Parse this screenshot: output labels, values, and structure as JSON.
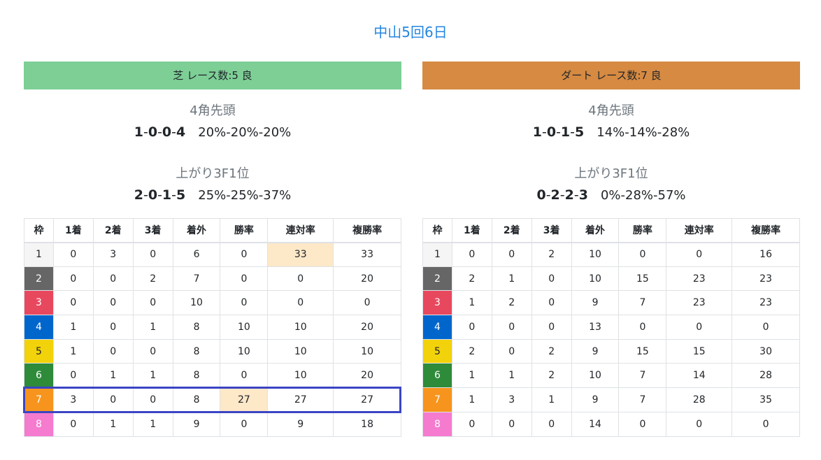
{
  "title": "中山5回6日",
  "headers": [
    "枠",
    "1着",
    "2着",
    "3着",
    "着外",
    "勝率",
    "連対率",
    "複勝率"
  ],
  "turf": {
    "header": "芝 レース数:5 良",
    "color": "#7dcf96",
    "sec1_label": "4角先頭",
    "sec1_rec": [
      "1",
      "0",
      "0",
      "4"
    ],
    "sec1_pct": "20%-20%-20%",
    "sec2_label": "上がり3F1位",
    "sec2_rec": [
      "2",
      "0",
      "1",
      "5"
    ],
    "sec2_pct": "25%-25%-37%",
    "rows": [
      [
        "1",
        "0",
        "3",
        "0",
        "6",
        "0",
        "33",
        "33"
      ],
      [
        "2",
        "0",
        "0",
        "2",
        "7",
        "0",
        "0",
        "20"
      ],
      [
        "3",
        "0",
        "0",
        "0",
        "10",
        "0",
        "0",
        "0"
      ],
      [
        "4",
        "1",
        "0",
        "1",
        "8",
        "10",
        "10",
        "20"
      ],
      [
        "5",
        "1",
        "0",
        "0",
        "8",
        "10",
        "10",
        "10"
      ],
      [
        "6",
        "0",
        "1",
        "1",
        "8",
        "0",
        "10",
        "20"
      ],
      [
        "7",
        "3",
        "0",
        "0",
        "8",
        "27",
        "27",
        "27"
      ],
      [
        "8",
        "0",
        "1",
        "1",
        "9",
        "0",
        "9",
        "18"
      ]
    ],
    "highlights": [
      [
        0,
        6
      ],
      [
        6,
        5
      ]
    ],
    "selected_row": 6
  },
  "dirt": {
    "header": "ダート レース数:7 良",
    "color": "#d68a42",
    "sec1_label": "4角先頭",
    "sec1_rec": [
      "1",
      "0",
      "1",
      "5"
    ],
    "sec1_pct": "14%-14%-28%",
    "sec2_label": "上がり3F1位",
    "sec2_rec": [
      "0",
      "2",
      "2",
      "3"
    ],
    "sec2_pct": "0%-28%-57%",
    "rows": [
      [
        "1",
        "0",
        "0",
        "2",
        "10",
        "0",
        "0",
        "16"
      ],
      [
        "2",
        "2",
        "1",
        "0",
        "10",
        "15",
        "23",
        "23"
      ],
      [
        "3",
        "1",
        "2",
        "0",
        "9",
        "7",
        "23",
        "23"
      ],
      [
        "4",
        "0",
        "0",
        "0",
        "13",
        "0",
        "0",
        "0"
      ],
      [
        "5",
        "2",
        "0",
        "2",
        "9",
        "15",
        "15",
        "30"
      ],
      [
        "6",
        "1",
        "1",
        "2",
        "10",
        "7",
        "14",
        "28"
      ],
      [
        "7",
        "1",
        "3",
        "1",
        "9",
        "7",
        "28",
        "35"
      ],
      [
        "8",
        "0",
        "0",
        "0",
        "14",
        "0",
        "0",
        "0"
      ]
    ],
    "highlights": [],
    "selected_row": -1
  },
  "frame_colors": [
    {
      "bg": "#f5f5f5",
      "fg": "#212529"
    },
    {
      "bg": "#666666",
      "fg": "#ffffff"
    },
    {
      "bg": "#e8485e",
      "fg": "#ffffff"
    },
    {
      "bg": "#0066cc",
      "fg": "#ffffff"
    },
    {
      "bg": "#f2d20a",
      "fg": "#212529"
    },
    {
      "bg": "#2e8b3a",
      "fg": "#ffffff"
    },
    {
      "bg": "#f7941d",
      "fg": "#ffffff"
    },
    {
      "bg": "#f57bcf",
      "fg": "#ffffff"
    }
  ]
}
